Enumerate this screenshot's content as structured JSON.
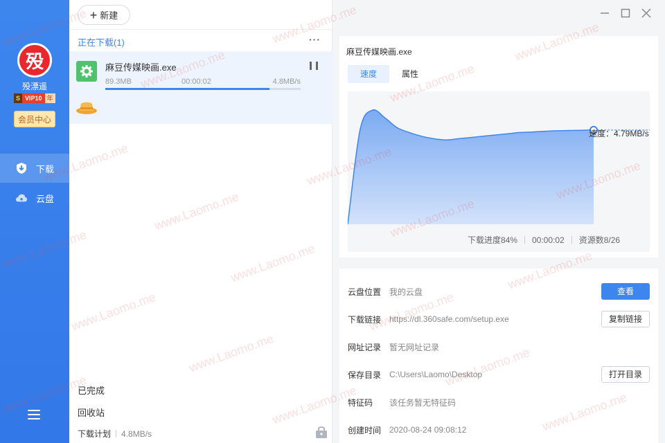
{
  "sidebar": {
    "logo_glyph": "殁",
    "app_name": "殁漂遥",
    "vip": {
      "s": "S",
      "level": "VIP10",
      "unit": "年"
    },
    "member_center": "会员中心",
    "nav": [
      {
        "label": "下载",
        "icon": "download-shield-icon",
        "active": true
      },
      {
        "label": "云盘",
        "icon": "cloud-icon",
        "active": false
      }
    ],
    "menu_icon": "hamburger-menu-icon"
  },
  "toolbar": {
    "new_label": "新建"
  },
  "downloads": {
    "section_title": "正在下载(1)",
    "items": [
      {
        "name": "麻豆传媒映画.exe",
        "size": "89.3MB",
        "elapsed": "00:00:02",
        "speed": "4.8MB/s",
        "progress": 0.84
      }
    ]
  },
  "bottom": {
    "completed": "已完成",
    "recycle": "回收站",
    "plan_label": "下载计划",
    "plan_value": "4.8MB/s"
  },
  "detail": {
    "file_name": "麻豆传媒映画.exe",
    "tabs": [
      "速度",
      "属性"
    ],
    "speed_label": "速度：4.79MB/s",
    "progress_text": "下载进度84%",
    "elapsed": "00:00:02",
    "sources": "资源数8/26"
  },
  "chart_data": {
    "type": "area",
    "x": [
      0,
      0.05,
      0.1,
      0.15,
      0.2,
      0.25,
      0.3,
      0.35,
      0.4,
      0.45,
      0.5,
      0.55,
      0.6,
      0.65,
      0.7,
      0.75,
      0.8,
      0.85,
      0.9,
      0.95,
      1.0
    ],
    "values": [
      0,
      3.8,
      4.6,
      4.3,
      3.9,
      3.7,
      3.55,
      3.45,
      3.4,
      3.45,
      3.5,
      3.55,
      3.6,
      3.65,
      3.7,
      3.72,
      3.75,
      3.77,
      3.78,
      3.79,
      3.8
    ],
    "current_label": "速度：4.79MB/s",
    "color": "#3d86ee"
  },
  "properties": {
    "rows": [
      {
        "label": "云盘位置",
        "value": "我的云盘",
        "button": "查看",
        "primary": true
      },
      {
        "label": "下载链接",
        "value": "https://dl.360safe.com/setup.exe",
        "button": "复制链接",
        "primary": false
      },
      {
        "label": "网址记录",
        "value": "暂无网址记录",
        "button": "",
        "primary": false
      },
      {
        "label": "保存目录",
        "value": "C:\\Users\\Laomo\\Desktop",
        "button": "打开目录",
        "primary": false
      },
      {
        "label": "特征码",
        "value": "该任务暂无特征码",
        "button": "",
        "primary": false
      },
      {
        "label": "创建时间",
        "value": "2020-08-24 09:08:12",
        "button": "",
        "primary": false
      }
    ]
  },
  "watermark_text": "www.Laomo.me",
  "colors": {
    "accent": "#3d86ee",
    "sidebar": "#3378e8",
    "logo": "#e8282e"
  }
}
